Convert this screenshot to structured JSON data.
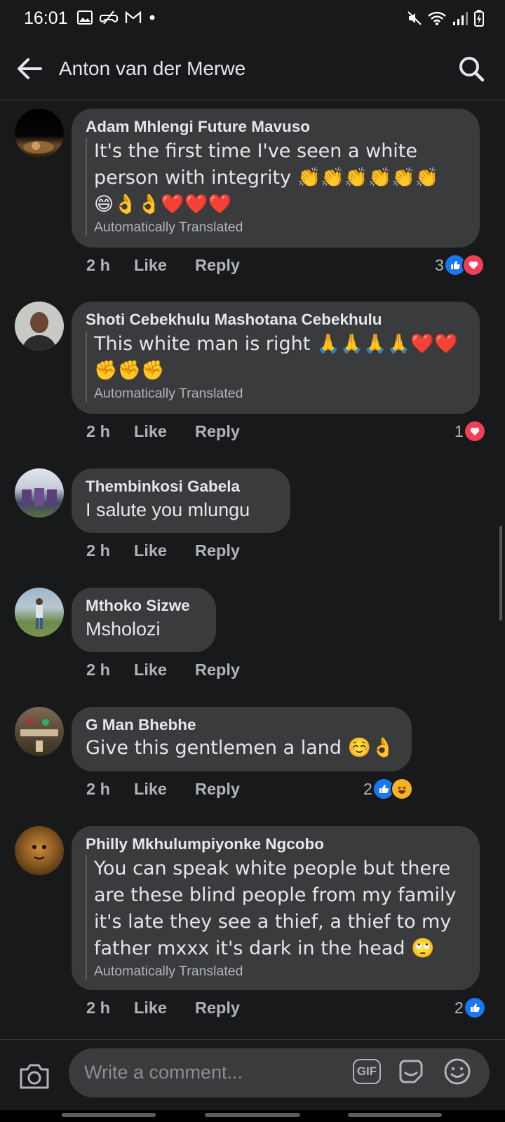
{
  "status_bar": {
    "time": "16:01",
    "left_icons": [
      "gallery-icon",
      "game-icon",
      "gmail-icon",
      "dot-icon"
    ],
    "right_icons": [
      "mute-icon",
      "wifi-icon",
      "signal-icon",
      "battery-charging-icon"
    ]
  },
  "header": {
    "title": "Anton van der Merwe"
  },
  "comments": [
    {
      "author": "Adam Mhlengi Future Mavuso",
      "body_lines": [
        "It's the first time I've seen a white",
        "person with integrity 👏👏👏👏👏👏",
        "😄👌👌❤️❤️❤️"
      ],
      "translated_note": "Automatically Translated",
      "time": "2 h",
      "like_label": "Like",
      "reply_label": "Reply",
      "reaction_count": "3",
      "reactions": [
        "like",
        "love"
      ]
    },
    {
      "author": "Shoti Cebekhulu Mashotana Cebekhulu",
      "body_lines": [
        "This white man is right 🙏🙏🙏🙏❤️❤️",
        "✊✊✊"
      ],
      "translated_note": "Automatically Translated",
      "time": "2 h",
      "like_label": "Like",
      "reply_label": "Reply",
      "reaction_count": "1",
      "reactions": [
        "love"
      ]
    },
    {
      "author": "Thembinkosi Gabela",
      "body_lines": [
        "I salute you mlungu"
      ],
      "time": "2 h",
      "like_label": "Like",
      "reply_label": "Reply"
    },
    {
      "author": "Mthoko Sizwe",
      "body_lines": [
        "Msholozi"
      ],
      "time": "2 h",
      "like_label": "Like",
      "reply_label": "Reply"
    },
    {
      "author": "G Man Bhebhe",
      "body_lines": [
        "Give this  gentlemen a land ☺️👌"
      ],
      "time": "2 h",
      "like_label": "Like",
      "reply_label": "Reply",
      "reaction_count": "2",
      "reactions": [
        "like",
        "haha"
      ]
    },
    {
      "author": "Philly Mkhulumpiyonke Ngcobo",
      "body_lines": [
        "You can speak white people but there",
        "are these blind people from my family",
        "it's late they see a thief, a thief to my",
        "father mxxx it's dark in the head 🙄"
      ],
      "translated_note": "Automatically Translated",
      "time": "2 h",
      "like_label": "Like",
      "reply_label": "Reply",
      "reaction_count": "2",
      "reactions": [
        "like"
      ]
    }
  ],
  "composer": {
    "placeholder": "Write a comment...",
    "gif_label": "GIF"
  },
  "colors": {
    "background": "#18191a",
    "bubble": "#3a3b3c",
    "text": "#e4e6eb",
    "secondary_text": "#b0b3b8",
    "like_blue": "#1877f2",
    "love_red": "#f33e58",
    "haha_yellow": "#f7b125"
  }
}
